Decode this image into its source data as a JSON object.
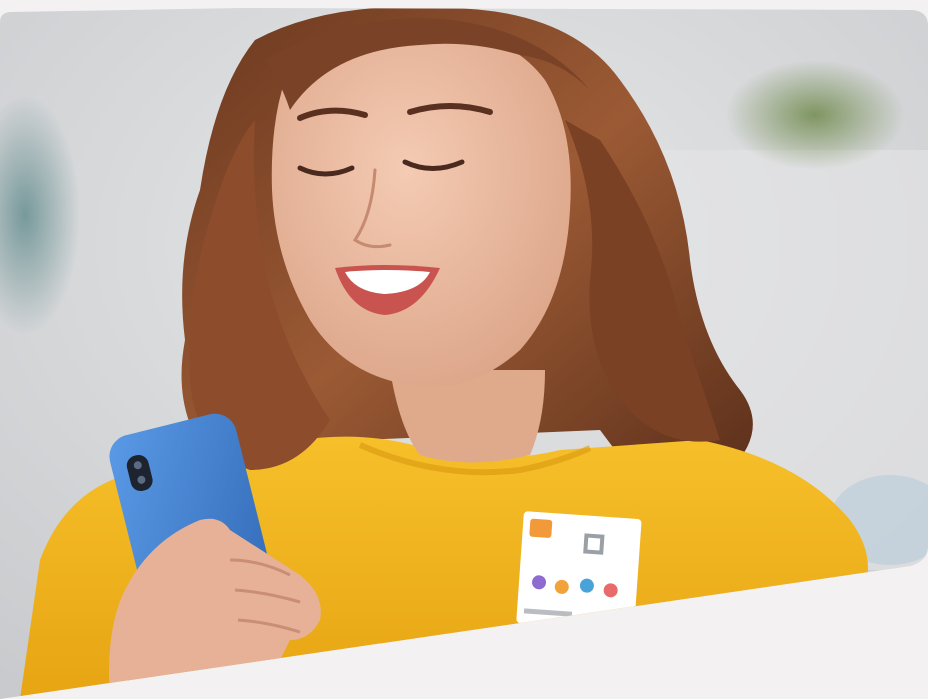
{
  "image": {
    "alt": "",
    "colors": {
      "page_background": "#f3f1f2",
      "wall": "#d9dadc",
      "sweater": "#f2b51e",
      "phone": "#3f7fd0",
      "hair": "#8a4a2b",
      "skin": "#e9b89f",
      "plant": "#6f8a4c"
    }
  }
}
